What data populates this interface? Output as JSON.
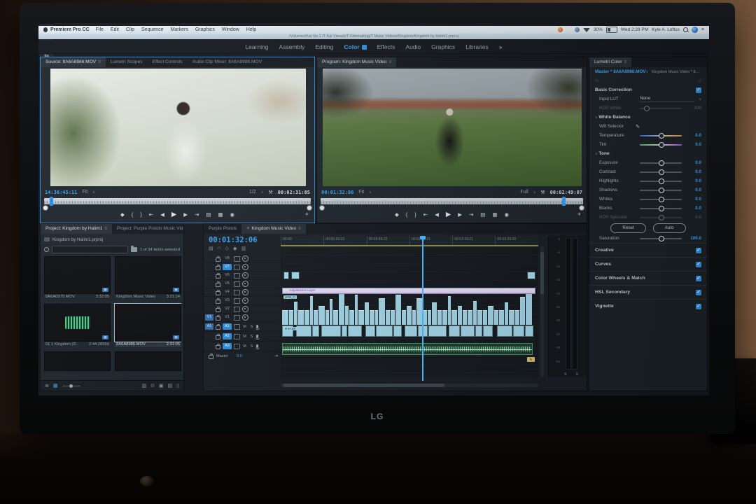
{
  "colors": {
    "accent_blue": "#2f8fe0",
    "timecode_blue": "#3aa6f5",
    "clip_cyan": "#a4d8ea",
    "audio_green": "#43996a",
    "adjustment_lavender": "#e8ddf4",
    "selection_focus": "#2f86ce"
  },
  "menu_bar": {
    "app_name": "Premiere Pro CC",
    "menus": [
      "File",
      "Edit",
      "Clip",
      "Sequence",
      "Markers",
      "Graphics",
      "Window",
      "Help"
    ],
    "battery": "30%",
    "clock": "Wed 2:28 PM",
    "user": "Kyle A. Loftus"
  },
  "title_bar": {
    "document_path": "/Volumes/Kai Vis 1 /T Kai Visuals/T Filmmaking/T Music Videos/Kingdom/Kingdom by Halim1.prproj"
  },
  "workspace_bar": {
    "tabs": [
      "Learning",
      "Assembly",
      "Editing",
      "Color",
      "Effects",
      "Audio",
      "Graphics",
      "Libraries"
    ],
    "active": "Color",
    "overflow": "»"
  },
  "transport_buttons": [
    {
      "name": "add-marker-button",
      "glyph": "◆"
    },
    {
      "name": "mark-in-button",
      "glyph": "{"
    },
    {
      "name": "mark-out-button",
      "glyph": "}"
    },
    {
      "name": "go-to-in-button",
      "glyph": "⇤"
    },
    {
      "name": "step-back-button",
      "glyph": "◀"
    },
    {
      "name": "play-button",
      "glyph": "▶"
    },
    {
      "name": "step-forward-button",
      "glyph": "▶"
    },
    {
      "name": "go-to-out-button",
      "glyph": "⇥"
    },
    {
      "name": "insert-button",
      "glyph": "▤"
    },
    {
      "name": "overwrite-button",
      "glyph": "▦"
    },
    {
      "name": "export-frame-button",
      "glyph": "◉"
    }
  ],
  "source_monitor": {
    "tabs": [
      {
        "label": "Source: 8A6A8986.MOV",
        "active": true
      },
      {
        "label": "Lumetri Scopes",
        "active": false
      },
      {
        "label": "Effect Controls",
        "active": false
      },
      {
        "label": "Audio Clip Mixer: 8A6A8986.MOV",
        "active": false
      }
    ],
    "current_timecode": "14:36:45:11",
    "zoom_level": "Fit",
    "playback_resolution": "1/2",
    "clip_duration": "00:02:31:05",
    "playhead_pct": 2,
    "add_button": "+"
  },
  "program_monitor": {
    "tab": "Program: Kingdom Music Video",
    "current_timecode": "00:01:32:06",
    "zoom_level": "Fit",
    "playback_resolution": "Full",
    "sequence_duration": "00:02:49:07",
    "playhead_pct": 92,
    "add_button": "+"
  },
  "lumetri": {
    "tab": "Lumetri Color",
    "clip_selector": "Master * 8A6A8986.MOV",
    "sequence_selector": "Kingdom Music Video * 8A6A8986...",
    "fx_badge": "fx",
    "basic_correction": {
      "title": "Basic Correction",
      "input_lut_label": "Input LUT",
      "input_lut_value": "None",
      "hdr_white": {
        "label": "HDR White",
        "value": "100"
      },
      "white_balance_label": "White Balance",
      "wb_selector_label": "WB Selector",
      "temperature": {
        "label": "Temperature",
        "value": "0.0"
      },
      "tint": {
        "label": "Tint",
        "value": "0.0"
      },
      "tone_label": "Tone",
      "tone_sliders": [
        {
          "label": "Exposure",
          "value": "0.0"
        },
        {
          "label": "Contrast",
          "value": "0.0"
        },
        {
          "label": "Highlights",
          "value": "0.0"
        },
        {
          "label": "Shadows",
          "value": "0.0"
        },
        {
          "label": "Whites",
          "value": "0.0"
        },
        {
          "label": "Blacks",
          "value": "0.0"
        }
      ],
      "hdr_specular": {
        "label": "HDR Specular",
        "value": "0.0"
      },
      "reset_label": "Reset",
      "auto_label": "Auto",
      "saturation": {
        "label": "Saturation",
        "value": "100.0"
      }
    },
    "sections": [
      {
        "label": "Creative",
        "enabled": true
      },
      {
        "label": "Curves",
        "enabled": true
      },
      {
        "label": "Color Wheels & Match",
        "enabled": true
      },
      {
        "label": "HSL Secondary",
        "enabled": true
      },
      {
        "label": "Vignette",
        "enabled": true
      }
    ]
  },
  "project_panel": {
    "tabs": [
      {
        "label": "Project: Kingdom by Halim1",
        "active": true
      },
      {
        "label": "Project: Purple Pistols Music Vid",
        "active": false
      }
    ],
    "overflow": "»",
    "project_file": "Kingdom by Halim1.prproj",
    "selection_status": "1 of 34 items selected",
    "clips": [
      {
        "name": "8A6A0970.MOV",
        "duration": "3:32:05",
        "kind": "video",
        "thumb": "sunlight"
      },
      {
        "name": "Kingdom Music Video",
        "duration": "3:21:14",
        "kind": "sequence",
        "thumb": "street"
      },
      {
        "name": "01 1 Kingdom (D..",
        "duration": "2:44:28656",
        "kind": "audio",
        "thumb": "waveform"
      },
      {
        "name": "8A6A8986.MOV",
        "duration": "2:31:05",
        "kind": "video",
        "thumb": "outdoor",
        "selected": true
      }
    ],
    "toolbar": [
      {
        "name": "list-view-button",
        "glyph": "≣",
        "active": false
      },
      {
        "name": "icon-view-button",
        "glyph": "▦",
        "active": true
      }
    ],
    "toolbar_right": [
      {
        "name": "automate-to-sequence-icon",
        "glyph": "▥"
      },
      {
        "name": "find-icon",
        "glyph": "⊙"
      },
      {
        "name": "new-bin-icon",
        "glyph": "▣"
      },
      {
        "name": "new-item-icon",
        "glyph": "▤"
      },
      {
        "name": "clear-icon",
        "glyph": "▯"
      }
    ]
  },
  "tools": [
    {
      "name": "selection-tool",
      "glyph": "▶",
      "active": true
    },
    {
      "name": "track-select-forward-tool",
      "glyph": "⇥"
    },
    {
      "name": "ripple-edit-tool",
      "glyph": "⇆"
    },
    {
      "name": "razor-tool",
      "glyph": "✂"
    },
    {
      "name": "slip-tool",
      "glyph": "↔"
    },
    {
      "name": "pen-tool",
      "glyph": "✎"
    },
    {
      "name": "hand-tool",
      "glyph": "⊕"
    },
    {
      "name": "type-tool",
      "glyph": "T"
    }
  ],
  "timeline": {
    "tabs": [
      {
        "label": "Purple Pistols",
        "active": false
      },
      {
        "label": "Kingdom Music Video",
        "active": true
      }
    ],
    "current_timecode": "00:01:32:06",
    "header_icons": [
      {
        "name": "timeline-display-settings-icon",
        "glyph": "▤"
      },
      {
        "name": "snap-toggle-icon",
        "glyph": "∩"
      },
      {
        "name": "linked-selection-icon",
        "glyph": "◇"
      },
      {
        "name": "add-marker-icon",
        "glyph": "◆"
      },
      {
        "name": "timeline-settings-wrench-icon",
        "glyph": "▥"
      }
    ],
    "ruler_labels": [
      "00:00",
      "00:00:29:23",
      "00:00:59:22",
      "00:01:29:21",
      "00:01:59:21",
      "00:02:29:20"
    ],
    "playhead_pct": 55,
    "video_tracks": [
      {
        "name": "V8"
      },
      {
        "name": "V7",
        "targeted": true
      },
      {
        "name": "V6"
      },
      {
        "name": "V5"
      },
      {
        "name": "V4"
      },
      {
        "name": "V3"
      },
      {
        "name": "V2"
      },
      {
        "name": "V1",
        "source_patch": "V1"
      }
    ],
    "audio_tracks": [
      {
        "name": "A1",
        "source_patch": "A1",
        "targeted": true
      },
      {
        "name": "A2",
        "targeted": true
      },
      {
        "name": "A3",
        "targeted": true
      }
    ],
    "master_label": "Master",
    "master_value": "0.0",
    "adjustment_layer_label": "Adjustment Layer",
    "clip_labels": {
      "upper": "02_C",
      "lower": "8A6A"
    },
    "segments_upper": [
      [
        9,
        45
      ],
      [
        6,
        45
      ],
      [
        5,
        72
      ],
      [
        8,
        45
      ],
      [
        7,
        45
      ],
      [
        4,
        92
      ],
      [
        6,
        45
      ],
      [
        9,
        60
      ],
      [
        5,
        45
      ],
      [
        4,
        82
      ],
      [
        7,
        45
      ],
      [
        8,
        100
      ],
      [
        5,
        60
      ],
      [
        7,
        45
      ],
      [
        4,
        95
      ],
      [
        8,
        45
      ],
      [
        6,
        70
      ],
      [
        7,
        45
      ],
      [
        4,
        45
      ],
      [
        9,
        85
      ],
      [
        6,
        45
      ],
      [
        6,
        45
      ],
      [
        8,
        95
      ],
      [
        6,
        45
      ],
      [
        7,
        60
      ],
      [
        5,
        45
      ],
      [
        8,
        85
      ],
      [
        6,
        45
      ],
      [
        5,
        45
      ],
      [
        7,
        70
      ],
      [
        6,
        45
      ],
      [
        7,
        45
      ],
      [
        4,
        90
      ],
      [
        8,
        45
      ],
      [
        6,
        60
      ],
      [
        6,
        45
      ],
      [
        7,
        45
      ],
      [
        5,
        75
      ],
      [
        7,
        45
      ],
      [
        6,
        45
      ],
      [
        8,
        60
      ],
      [
        6,
        45
      ],
      [
        7,
        45
      ],
      [
        5,
        70
      ],
      [
        8,
        45
      ],
      [
        6,
        45
      ],
      [
        7,
        88
      ],
      [
        9,
        100
      ]
    ],
    "segments_lower": [
      16,
      -2,
      22,
      10,
      -1,
      28,
      8,
      20,
      -3,
      14,
      24,
      12,
      -2,
      18,
      14,
      26,
      -1,
      16,
      20,
      10,
      14,
      -4,
      22,
      16,
      12,
      -2,
      18,
      10,
      8
    ],
    "meter_ticks": [
      "0",
      "-6",
      "-12",
      "-18",
      "-24",
      "-30",
      "-36",
      "-42",
      "-48",
      "-54"
    ],
    "solo_labels": "S S",
    "fx_badge": "fx"
  },
  "monitor": {
    "brand": "LG"
  }
}
